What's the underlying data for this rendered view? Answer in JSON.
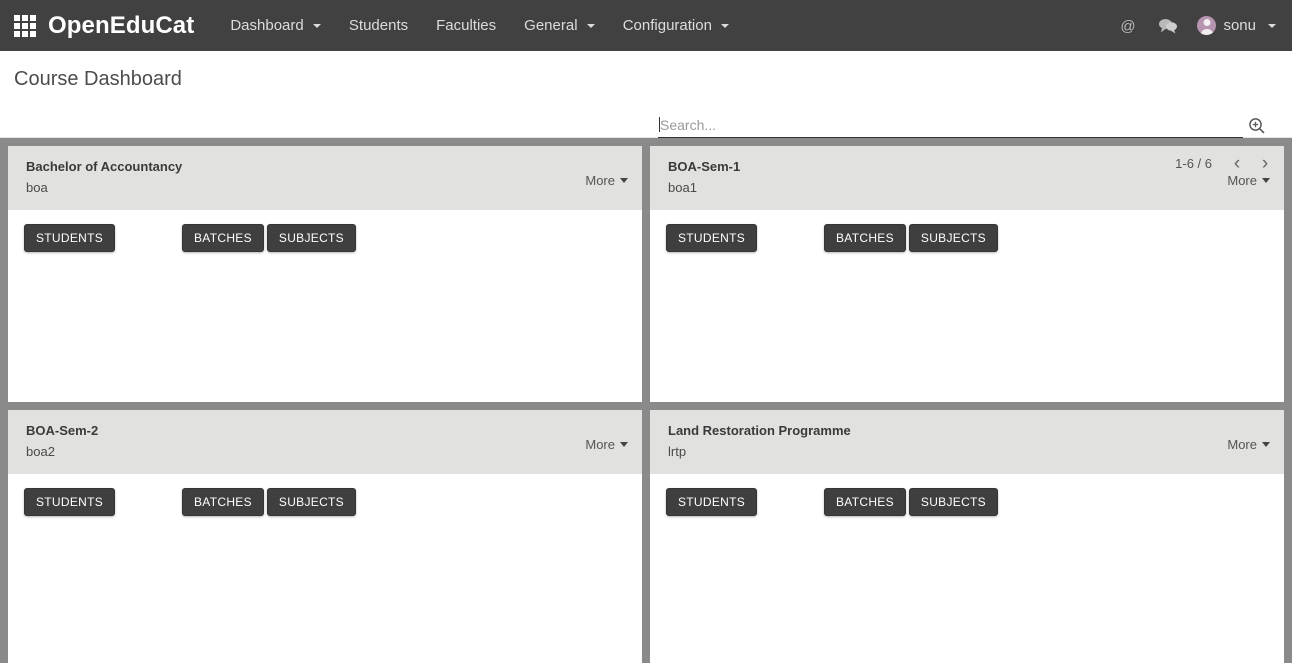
{
  "navbar": {
    "apps_icon": "apps-grid-icon",
    "brand": "OpenEduCat",
    "menu": [
      {
        "label": "Dashboard",
        "has_caret": true
      },
      {
        "label": "Students",
        "has_caret": false
      },
      {
        "label": "Faculties",
        "has_caret": false
      },
      {
        "label": "General",
        "has_caret": true
      },
      {
        "label": "Configuration",
        "has_caret": true
      }
    ],
    "mail_icon": "at-sign-icon",
    "chat_icon": "chat-bubbles-icon",
    "user_name": "sonu"
  },
  "control_panel": {
    "page_title": "Course Dashboard",
    "search_placeholder": "Search...",
    "search_value": "",
    "search_icon": "magnifier-plus-icon",
    "pager_label": "1-6 / 6",
    "prev_label": "‹",
    "next_label": "›"
  },
  "board": {
    "more_label": "More",
    "buttons": {
      "students": "STUDENTS",
      "batches": "BATCHES",
      "subjects": "SUBJECTS"
    },
    "cards": [
      {
        "title": "Bachelor of Accountancy",
        "code": "boa"
      },
      {
        "title": "BOA-Sem-1",
        "code": "boa1"
      },
      {
        "title": "BOA-Sem-2",
        "code": "boa2"
      },
      {
        "title": "Land Restoration Programme",
        "code": "lrtp"
      }
    ]
  },
  "colors": {
    "navbar_bg": "#414141",
    "board_bg": "#8a8a8a",
    "card_header_bg": "#e1e1df",
    "button_bg": "#3f3f3f",
    "avatar_bg": "#b795b0"
  }
}
